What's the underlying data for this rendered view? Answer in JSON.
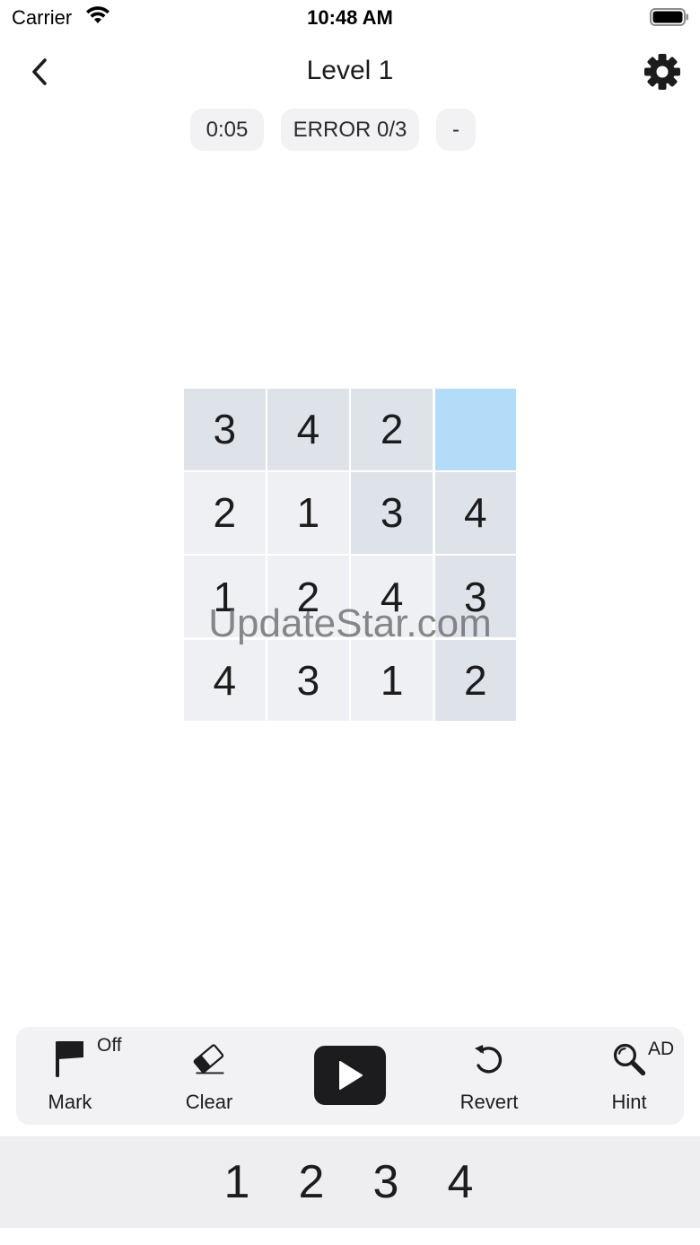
{
  "status_bar": {
    "carrier": "Carrier",
    "time": "10:48 AM"
  },
  "nav": {
    "title": "Level 1",
    "back_icon": "chevron-left-icon",
    "settings_icon": "gear-icon"
  },
  "info": {
    "timer": "0:05",
    "errors": "ERROR 0/3",
    "extra": "-"
  },
  "board": {
    "size": 4,
    "selected_cell": {
      "row": 0,
      "col": 3
    },
    "cells": [
      {
        "value": "3",
        "state": "given"
      },
      {
        "value": "4",
        "state": "given"
      },
      {
        "value": "2",
        "state": "given"
      },
      {
        "value": "",
        "state": "selected"
      },
      {
        "value": "2",
        "state": "filled"
      },
      {
        "value": "1",
        "state": "filled"
      },
      {
        "value": "3",
        "state": "given"
      },
      {
        "value": "4",
        "state": "given"
      },
      {
        "value": "1",
        "state": "filled"
      },
      {
        "value": "2",
        "state": "filled"
      },
      {
        "value": "4",
        "state": "filled"
      },
      {
        "value": "3",
        "state": "given"
      },
      {
        "value": "4",
        "state": "filled"
      },
      {
        "value": "3",
        "state": "filled"
      },
      {
        "value": "1",
        "state": "filled"
      },
      {
        "value": "2",
        "state": "given"
      }
    ]
  },
  "watermark": "UpdateStar.com",
  "toolbar": {
    "mark": {
      "label": "Mark",
      "badge": "Off",
      "icon": "flag-icon"
    },
    "clear": {
      "label": "Clear",
      "icon": "eraser-icon"
    },
    "play": {
      "icon": "play-icon"
    },
    "revert": {
      "label": "Revert",
      "icon": "undo-icon"
    },
    "hint": {
      "label": "Hint",
      "badge": "AD",
      "icon": "magnifier-icon"
    }
  },
  "numpad": [
    "1",
    "2",
    "3",
    "4"
  ],
  "colors": {
    "given_cell": "#dde3e8",
    "filled_cell": "#eff0f3",
    "selected_cell": "#b3dcf8",
    "toolbar_bg": "#f2f2f4",
    "numpad_bg": "#eeeef1"
  }
}
